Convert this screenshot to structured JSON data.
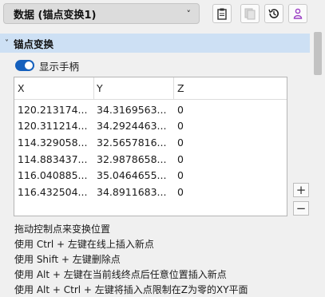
{
  "header": {
    "title": "数据 (锚点变换1)",
    "dropdown_chevron": "chevron-down-icon"
  },
  "toolbar": {
    "buttons": [
      {
        "name": "copy-button",
        "icon": "clipboard-icon"
      },
      {
        "name": "paste-button",
        "icon": "paste-icon"
      },
      {
        "name": "reset-button",
        "icon": "history-icon"
      },
      {
        "name": "user-button",
        "icon": "person-icon"
      }
    ]
  },
  "section": {
    "title": "锚点变换",
    "expanded": true
  },
  "toggle": {
    "label": "显示手柄",
    "on": true
  },
  "table": {
    "headers": [
      "X",
      "Y",
      "Z"
    ],
    "rows": [
      [
        "120.213174...",
        "34.3169563...",
        "0"
      ],
      [
        "120.311214...",
        "34.2924463...",
        "0"
      ],
      [
        "114.329058...",
        "32.5657816...",
        "0"
      ],
      [
        "114.883437...",
        "32.9878658...",
        "0"
      ],
      [
        "116.040885...",
        "35.0464655...",
        "0"
      ],
      [
        "116.432504...",
        "34.8911683...",
        "0"
      ]
    ]
  },
  "side_buttons": {
    "add": "+",
    "remove": "−"
  },
  "help": [
    "拖动控制点来变换位置",
    "使用 Ctrl + 左键在线上插入新点",
    "使用 Shift + 左键删除点",
    "使用 Alt + 左键在当前线终点后任意位置插入新点",
    "使用 Alt + Ctrl + 左键将插入点限制在Z为零的XY平面"
  ],
  "colors": {
    "section_bg": "#cde0f4",
    "toggle_on": "#1560bd",
    "user_icon": "#9b3fc4"
  }
}
